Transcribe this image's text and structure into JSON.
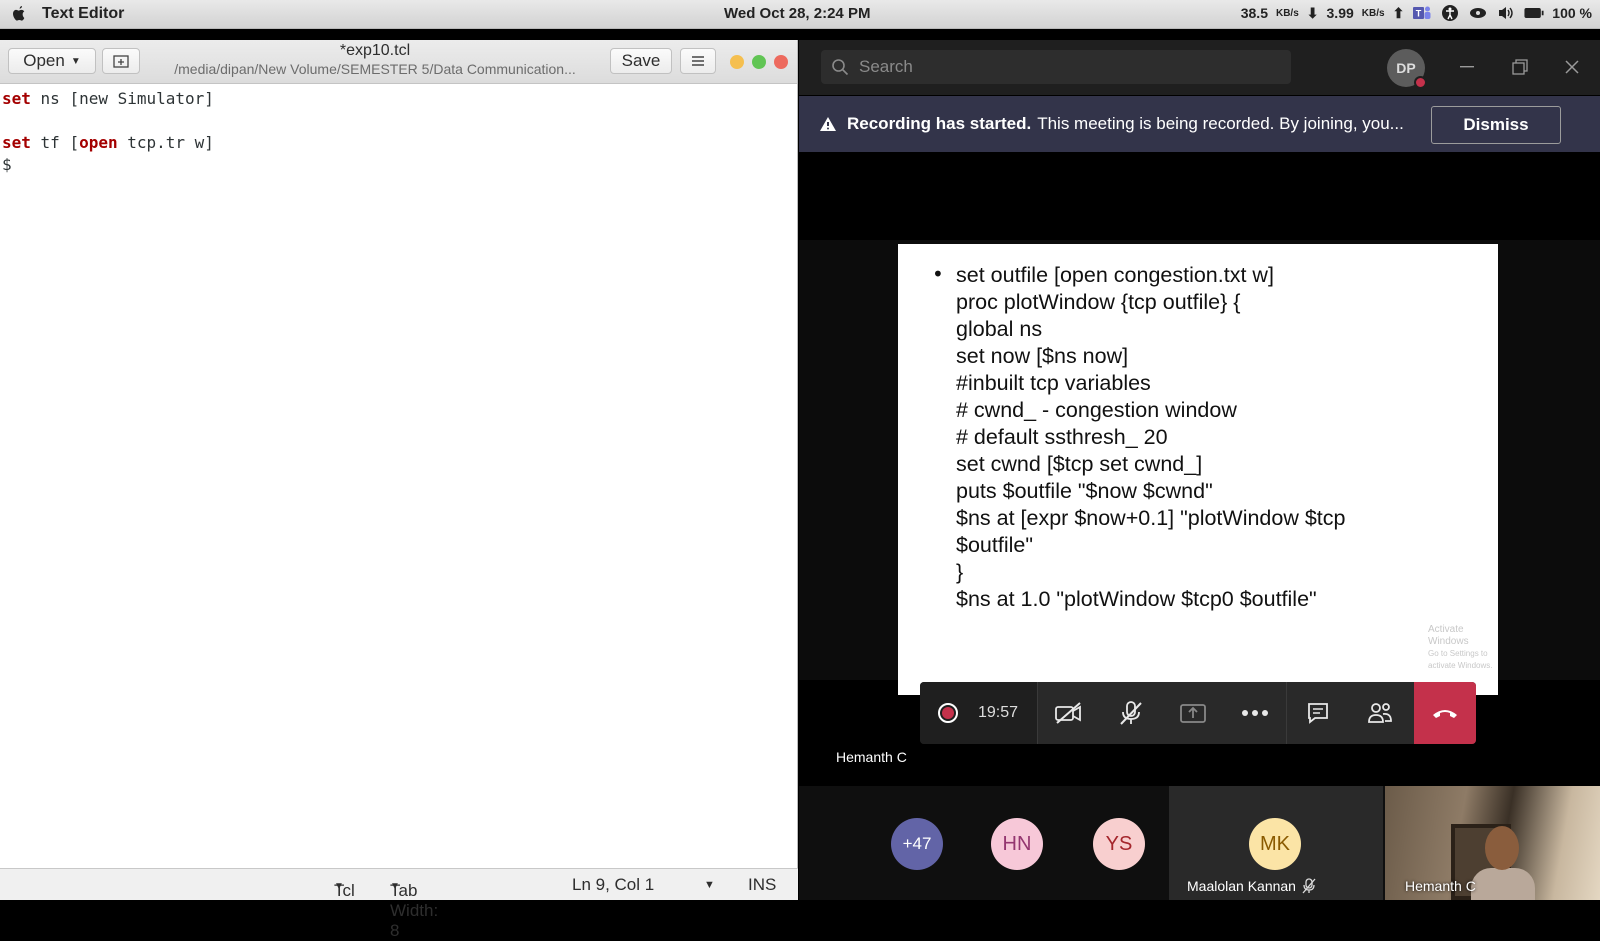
{
  "menubar": {
    "app_name": "Text Editor",
    "datetime": "Wed Oct 28,  2:24 PM",
    "download_speed": "38.5",
    "download_unit": "KB/s",
    "upload_speed": "3.99",
    "upload_unit": "KB/s",
    "battery": "100 %"
  },
  "editor": {
    "open_label": "Open",
    "save_label": "Save",
    "filename": "*exp10.tcl",
    "path": "/media/dipan/New Volume/SEMESTER 5/Data Communication...",
    "lines": [
      {
        "kw": "set",
        "rest": " ns [new Simulator]"
      },
      {
        "kw": "",
        "rest": ""
      },
      {
        "kw": "set",
        "rest": " tf [",
        "kw2": "open",
        "rest2": " tcp.tr w]"
      },
      {
        "kw": "",
        "rest": "$"
      }
    ],
    "status": {
      "language": "Tcl",
      "tab_width": "Tab Width: 8",
      "position": "Ln 9, Col 1",
      "mode": "INS"
    }
  },
  "teams": {
    "search_placeholder": "Search",
    "user_initials": "DP",
    "banner_bold": "Recording has started.",
    "banner_text": "This meeting is being recorded. By joining, you...",
    "dismiss_label": "Dismiss",
    "call_timer": "19:57",
    "presenter_name": "Hemanth C",
    "participants": {
      "overflow": "+47",
      "p1": "HN",
      "p2": "YS",
      "p3_initials": "MK",
      "p3_name": "Maalolan Kannan",
      "video_name": "Hemanth C"
    }
  },
  "slide": {
    "lines": [
      "set outfile [open congestion.txt w]",
      "proc plotWindow {tcp outfile} {",
      "global ns",
      "set now [$ns now]",
      "#inbuilt tcp variables",
      "# cwnd_ - congestion window",
      "# default ssthresh_ 20",
      "set cwnd [$tcp set cwnd_]",
      "puts $outfile \"$now $cwnd\"",
      "$ns at [expr $now+0.1] \"plotWindow $tcp",
      "$outfile\"",
      "}",
      "$ns at 1.0 \"plotWindow $tcp0 $outfile\""
    ],
    "watermark_title": "Activate Windows",
    "watermark_sub": "Go to Settings to activate Windows."
  },
  "colors": {
    "teams_purple": "#6264a7",
    "hangup_red": "#c4314b",
    "banner_bg": "#33344a",
    "tcl_keyword": "#a40000"
  }
}
